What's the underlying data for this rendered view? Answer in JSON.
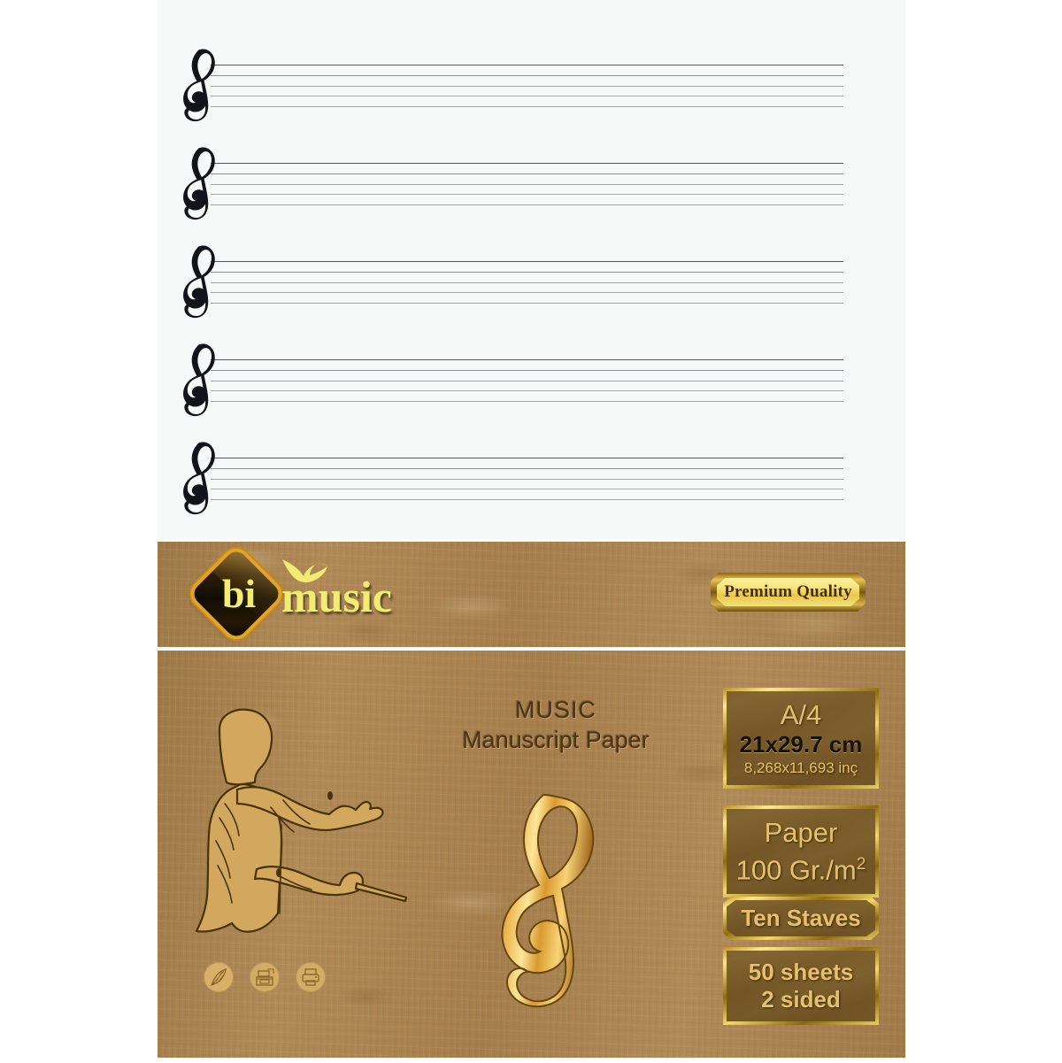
{
  "product": {
    "brand_mark": "bi",
    "brand_word": "music",
    "brand_bird_icon": "bird-icon",
    "badge_label": "Premium Quality",
    "title_line1": "MUSIC",
    "title_line2": "Manuscript Paper",
    "conductor_icon": "conductor-silhouette-icon",
    "treble_clef_icon": "treble-clef-icon"
  },
  "specs": [
    {
      "id": "size",
      "line1": "A/4",
      "line2": "21x29.7 cm",
      "line3": "8,268x11,693 inç"
    },
    {
      "id": "paper-weight",
      "line1": "Paper",
      "line2": "100 Gr./m",
      "line2_sup": "2"
    },
    {
      "id": "staves",
      "line1": "Ten Staves"
    },
    {
      "id": "sheet-count",
      "line1": "50 sheets",
      "line2": "2 sided"
    }
  ],
  "usage_icons": [
    {
      "name": "quill-pen-icon"
    },
    {
      "name": "copier-icon"
    },
    {
      "name": "printer-icon"
    }
  ],
  "manuscript": {
    "stave_count": 5,
    "lines_per_stave": 5,
    "clef_icon": "treble-clef-icon"
  },
  "colors": {
    "kraft": "#a67f4f",
    "gold": "#e6c16a",
    "gold_bright": "#f2ec72",
    "sheet": "#f7f8f8",
    "staff_line": "#9a9ea1",
    "title_text": "#4f3414"
  }
}
